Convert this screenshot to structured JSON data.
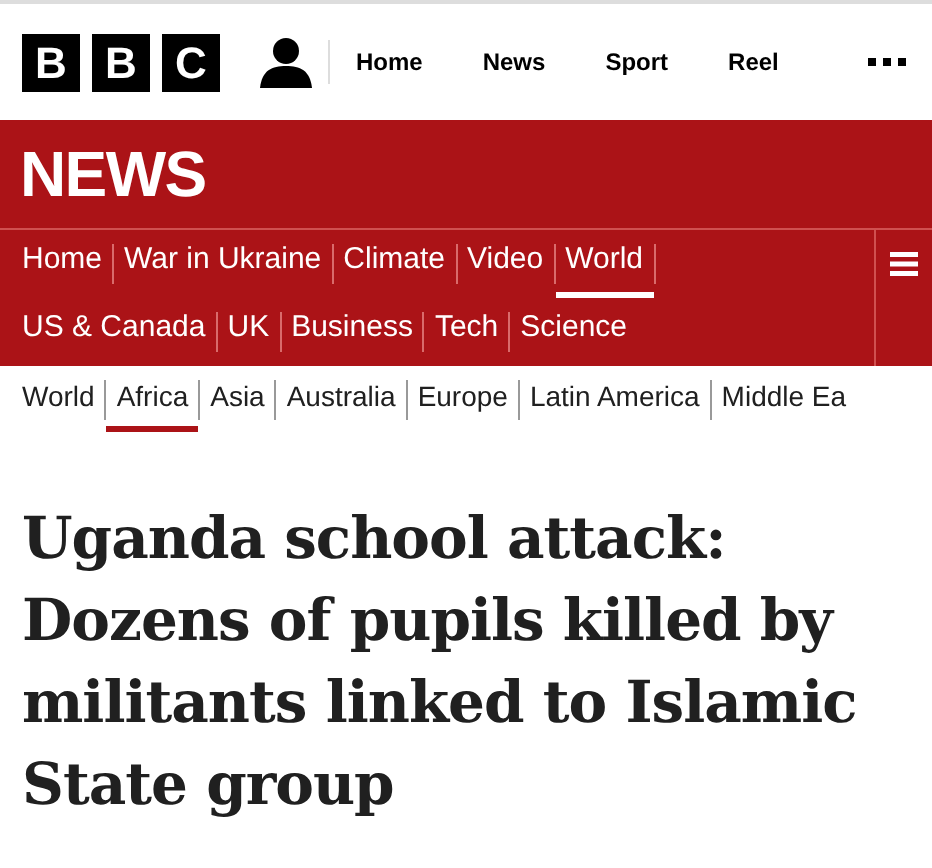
{
  "logo": {
    "letters": [
      "B",
      "B",
      "C"
    ]
  },
  "top_nav": [
    "Home",
    "News",
    "Sport",
    "Reel"
  ],
  "section_title": "NEWS",
  "main_nav": [
    {
      "label": "Home",
      "selected": false
    },
    {
      "label": "War in Ukraine",
      "selected": false
    },
    {
      "label": "Climate",
      "selected": false
    },
    {
      "label": "Video",
      "selected": false
    },
    {
      "label": "World",
      "selected": true
    },
    {
      "label": "US & Canada",
      "selected": false
    },
    {
      "label": "UK",
      "selected": false
    },
    {
      "label": "Business",
      "selected": false
    },
    {
      "label": "Tech",
      "selected": false
    },
    {
      "label": "Science",
      "selected": false
    }
  ],
  "sub_nav": [
    {
      "label": "World",
      "selected": false
    },
    {
      "label": "Africa",
      "selected": true
    },
    {
      "label": "Asia",
      "selected": false
    },
    {
      "label": "Australia",
      "selected": false
    },
    {
      "label": "Europe",
      "selected": false
    },
    {
      "label": "Latin America",
      "selected": false
    },
    {
      "label": "Middle Ea",
      "selected": false
    }
  ],
  "headline": "Uganda school attack: Dozens of pupils killed by militants linked to Islamic State group"
}
